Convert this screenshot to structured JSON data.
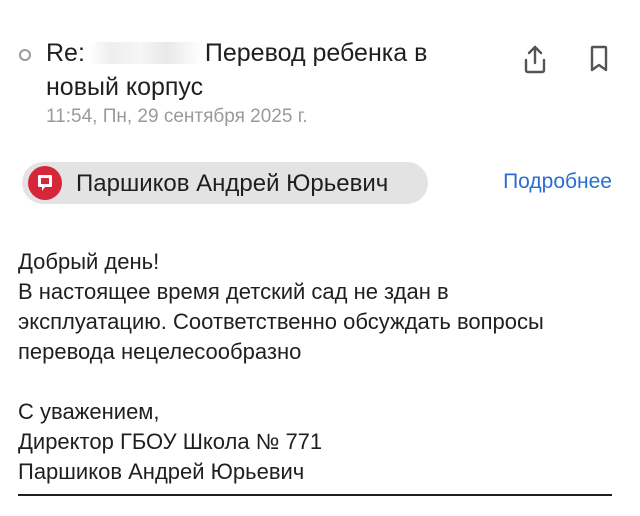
{
  "email": {
    "subject_prefix": "Re:",
    "subject_text": "Перевод ребенка в",
    "subject_text_line2": "новый корпус",
    "date": "11:54, Пн, 29 сентября 2025 г."
  },
  "sender": {
    "name": "Паршиков Андрей Юрьевич",
    "avatar_color": "#d5263a"
  },
  "actions": {
    "details_label": "Подробнее",
    "share_icon": "share-icon",
    "bookmark_icon": "bookmark-icon"
  },
  "body": {
    "greeting": "Добрый день!",
    "lines": [
      "В настоящее время детский сад не здан в",
      "эксплуатацию. Соответственно обсуждать вопросы",
      "перевода нецелесообразно"
    ],
    "closing": "С уважением,",
    "signature_lines": [
      "Директор ГБОУ Школа № 771",
      "Паршиков Андрей Юрьевич"
    ]
  },
  "colors": {
    "link": "#2a6fcf",
    "muted": "#9a9a9a",
    "chip_bg": "#e3e3e3"
  }
}
